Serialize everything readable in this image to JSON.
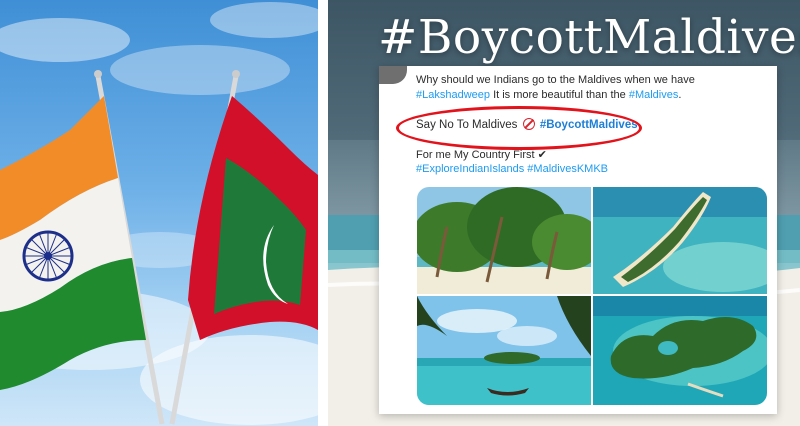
{
  "headline": "#BoycottMaldives",
  "tweet": {
    "line1_prefix": "Why should we Indians go to the Maldives when we have ",
    "line1_tag": "#Lakshadweep",
    "line1_mid": " It is more beautiful than the ",
    "line1_tag2": "#Maldives",
    "line1_end": ".",
    "say_text": "Say No To Maldives",
    "say_tag": "#BoycottMaldives",
    "me_text": "For me My Country First",
    "me_mark": "✔",
    "tags": "#ExploreIndianIslands #MaldivesKMKB"
  },
  "colors": {
    "india_saffron": "#f28c28",
    "india_green": "#1f8a2e",
    "india_chakra": "#1c2f8a",
    "maldives_red": "#d2102a",
    "maldives_green": "#1f7a3a",
    "highlight_oval": "#e3131c",
    "hashtag_blue": "#1d9bf0"
  },
  "images": [
    "palm-beach-photo",
    "island-aerial-photo",
    "lagoon-boat-photo",
    "heart-island-aerial-photo"
  ]
}
